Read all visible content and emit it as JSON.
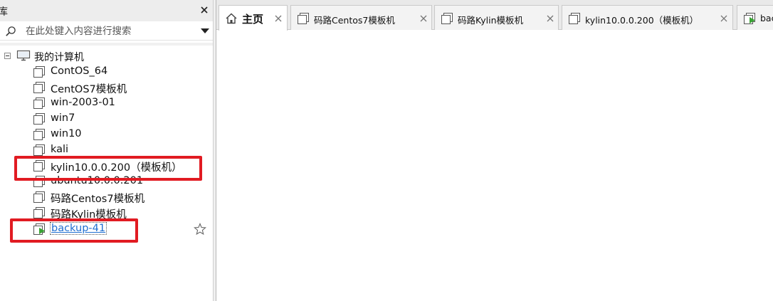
{
  "library": {
    "title": "库",
    "search_placeholder": "在此处键入内容进行搜索",
    "root": {
      "label": "我的计算机",
      "items": [
        {
          "label": "ContOS_64"
        },
        {
          "label": "CentOS7模板机"
        },
        {
          "label": "win-2003-01"
        },
        {
          "label": "win7"
        },
        {
          "label": "win10"
        },
        {
          "label": "kali"
        },
        {
          "label": "kylin10.0.0.200（模板机）"
        },
        {
          "label": "ubuntu10.0.0.201"
        },
        {
          "label": "码路Centos7模板机"
        },
        {
          "label": "码路Kylin模板机"
        },
        {
          "label": "backup-41"
        }
      ]
    }
  },
  "tabs": [
    {
      "label": "主页"
    },
    {
      "label": "码路Centos7模板机"
    },
    {
      "label": "码路Kylin模板机"
    },
    {
      "label": "kylin10.0.0.200（模板机）"
    },
    {
      "label": "bac"
    }
  ],
  "colors": {
    "highlight_box": "#e11b22",
    "selected_text": "#1f6fd1",
    "running_indicator": "#3aa335"
  }
}
